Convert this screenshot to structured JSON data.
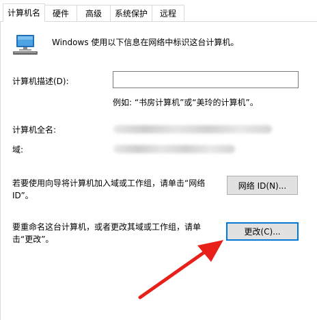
{
  "tabs": [
    {
      "label": "计算机名",
      "active": true
    },
    {
      "label": "硬件",
      "active": false
    },
    {
      "label": "高级",
      "active": false
    },
    {
      "label": "系统保护",
      "active": false
    },
    {
      "label": "远程",
      "active": false
    }
  ],
  "intro": {
    "icon": "computer-network-icon",
    "text": "Windows 使用以下信息在网络中标识这台计算机。"
  },
  "description": {
    "label": "计算机描述(D):",
    "value": "",
    "example": "例如: “书房计算机”或“美玲的计算机”。"
  },
  "full_name": {
    "label": "计算机全名:"
  },
  "domain": {
    "label": "域:"
  },
  "network_id": {
    "text": "若要使用向导将计算机加入域或工作组，请单击“网络 ID”。",
    "button_label": "网络 ID(N)..."
  },
  "rename": {
    "text": "要重命名这台计算机，或者更改其域或工作组，请单击“更改”。",
    "button_label": "更改(C)..."
  },
  "annotation": {
    "icon": "red-arrow-icon",
    "color": "#e8201a"
  },
  "colors": {
    "focus_border": "#0078d7",
    "button_bg": "#e1e1e1"
  }
}
